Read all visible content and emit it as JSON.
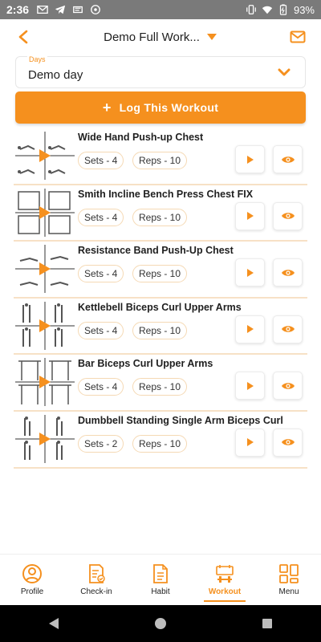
{
  "status_bar": {
    "time": "2:36",
    "battery": "93%"
  },
  "header": {
    "title": "Demo Full Workout",
    "title_display": "Demo Full Work..."
  },
  "days": {
    "label": "Days",
    "value": "Demo day"
  },
  "log_button": {
    "label": "Log This Workout"
  },
  "exercises": [
    {
      "name": "Wide Hand Push-up Chest",
      "sets": "Sets - 4",
      "reps": "Reps - 10"
    },
    {
      "name": "Smith Incline Bench Press Chest FIX",
      "sets": "Sets - 4",
      "reps": "Reps - 10"
    },
    {
      "name": "Resistance Band Push-Up Chest",
      "sets": "Sets - 4",
      "reps": "Reps - 10"
    },
    {
      "name": "Kettlebell Biceps Curl Upper Arms",
      "sets": "Sets - 4",
      "reps": "Reps - 10"
    },
    {
      "name": "Bar Biceps Curl Upper Arms",
      "sets": "Sets - 4",
      "reps": "Reps - 10"
    },
    {
      "name": "Dumbbell Standing Single Arm Biceps Curl",
      "sets": "Sets - 2",
      "reps": "Reps - 10"
    }
  ],
  "bottom_nav": [
    {
      "label": "Profile",
      "icon": "profile-icon"
    },
    {
      "label": "Check-in",
      "icon": "checkin-icon"
    },
    {
      "label": "Habit",
      "icon": "habit-icon"
    },
    {
      "label": "Workout",
      "icon": "workout-icon",
      "active": true
    },
    {
      "label": "Menu",
      "icon": "menu-grid-icon"
    }
  ],
  "colors": {
    "accent": "#f5901e",
    "chip_border": "#f5d9b4",
    "divider": "#f7e1c6",
    "status_bar": "#7a7a7a"
  }
}
